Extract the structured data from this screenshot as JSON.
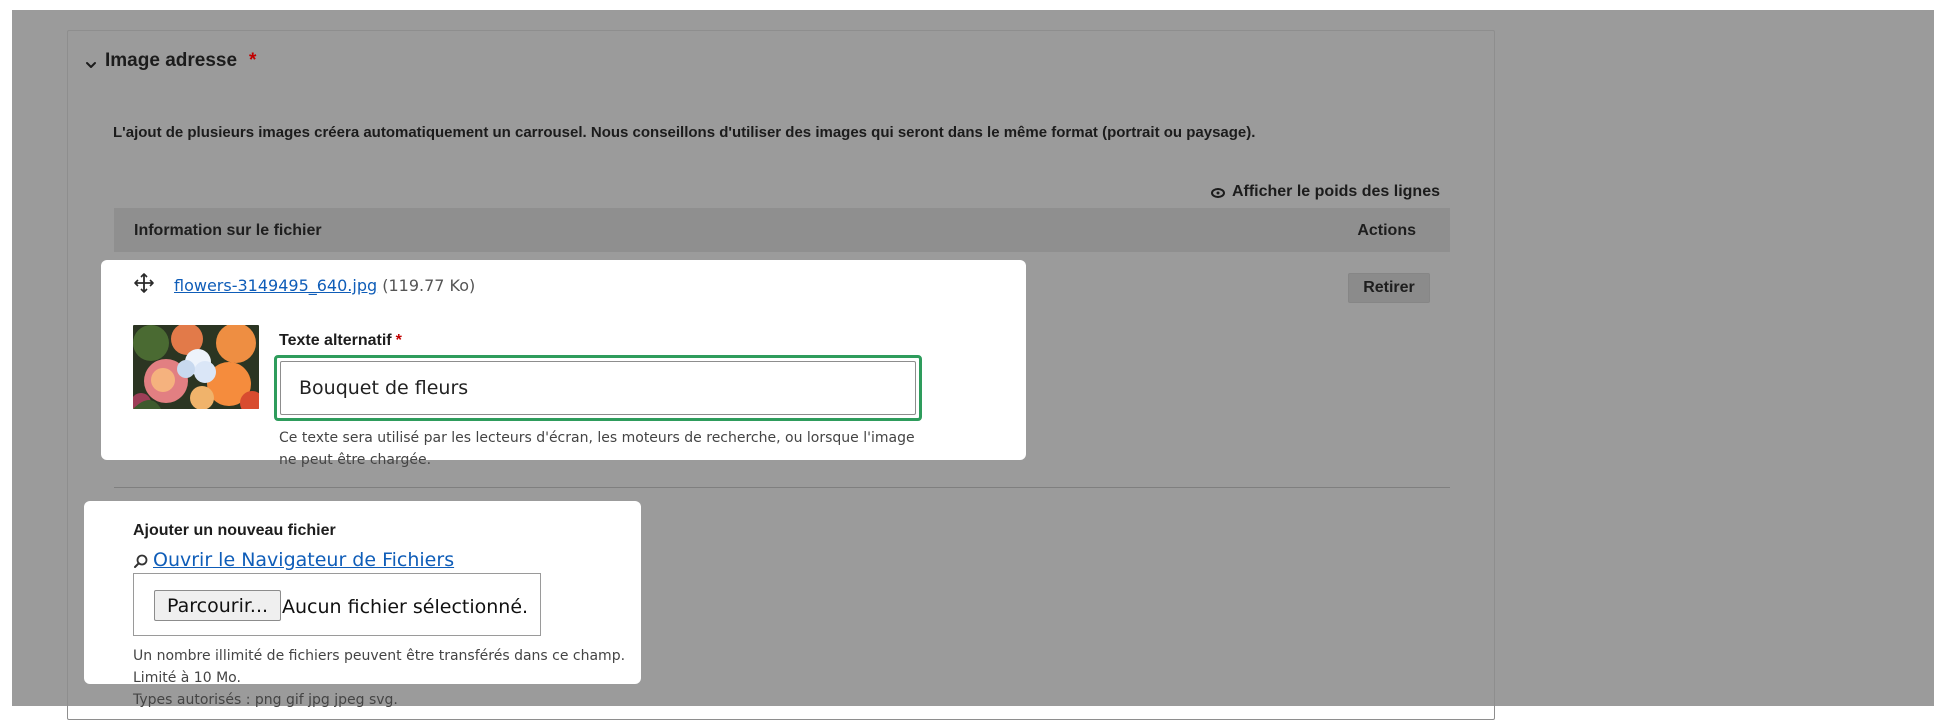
{
  "section": {
    "title": "Image adresse",
    "required_mark": "*",
    "description": "L'ajout de plusieurs images créera automatiquement un carrousel. Nous conseillons d'utiliser des images qui seront dans le même format (portrait ou paysage).",
    "row_weights_toggle": "Afficher le poids des lignes"
  },
  "table": {
    "headers": {
      "info": "Information sur le fichier",
      "actions": "Actions"
    }
  },
  "file_item": {
    "filename": "flowers-3149495_640.jpg",
    "size": "(119.77 Ko)",
    "remove_label": "Retirer",
    "alt_label": "Texte alternatif",
    "alt_required_mark": "*",
    "alt_value": "Bouquet de fleurs",
    "alt_help": "Ce texte sera utilisé par les lecteurs d'écran, les moteurs de recherche, ou lorsque l'image ne peut être chargée."
  },
  "upload": {
    "title": "Ajouter un nouveau fichier",
    "browser_link": "Ouvrir le Navigateur de Fichiers",
    "browse_button": "Parcourir...",
    "no_file_text": "Aucun fichier sélectionné.",
    "help_unlimited": "Un nombre illimité de fichiers peuvent être transférés dans ce champ.",
    "help_limit": "Limité à 10 Mo.",
    "help_types": "Types autorisés : png gif jpg jpeg svg."
  },
  "icons": {
    "collapse": "chevron-down-icon",
    "eye": "eye-icon",
    "drag": "move-icon",
    "browser": "magnifier-icon"
  },
  "colors": {
    "overlay": "#9b9b9b",
    "card": "#ffffff",
    "focus_ring": "#2e9c5c",
    "link": "#0f5db8",
    "required": "#c20000"
  }
}
